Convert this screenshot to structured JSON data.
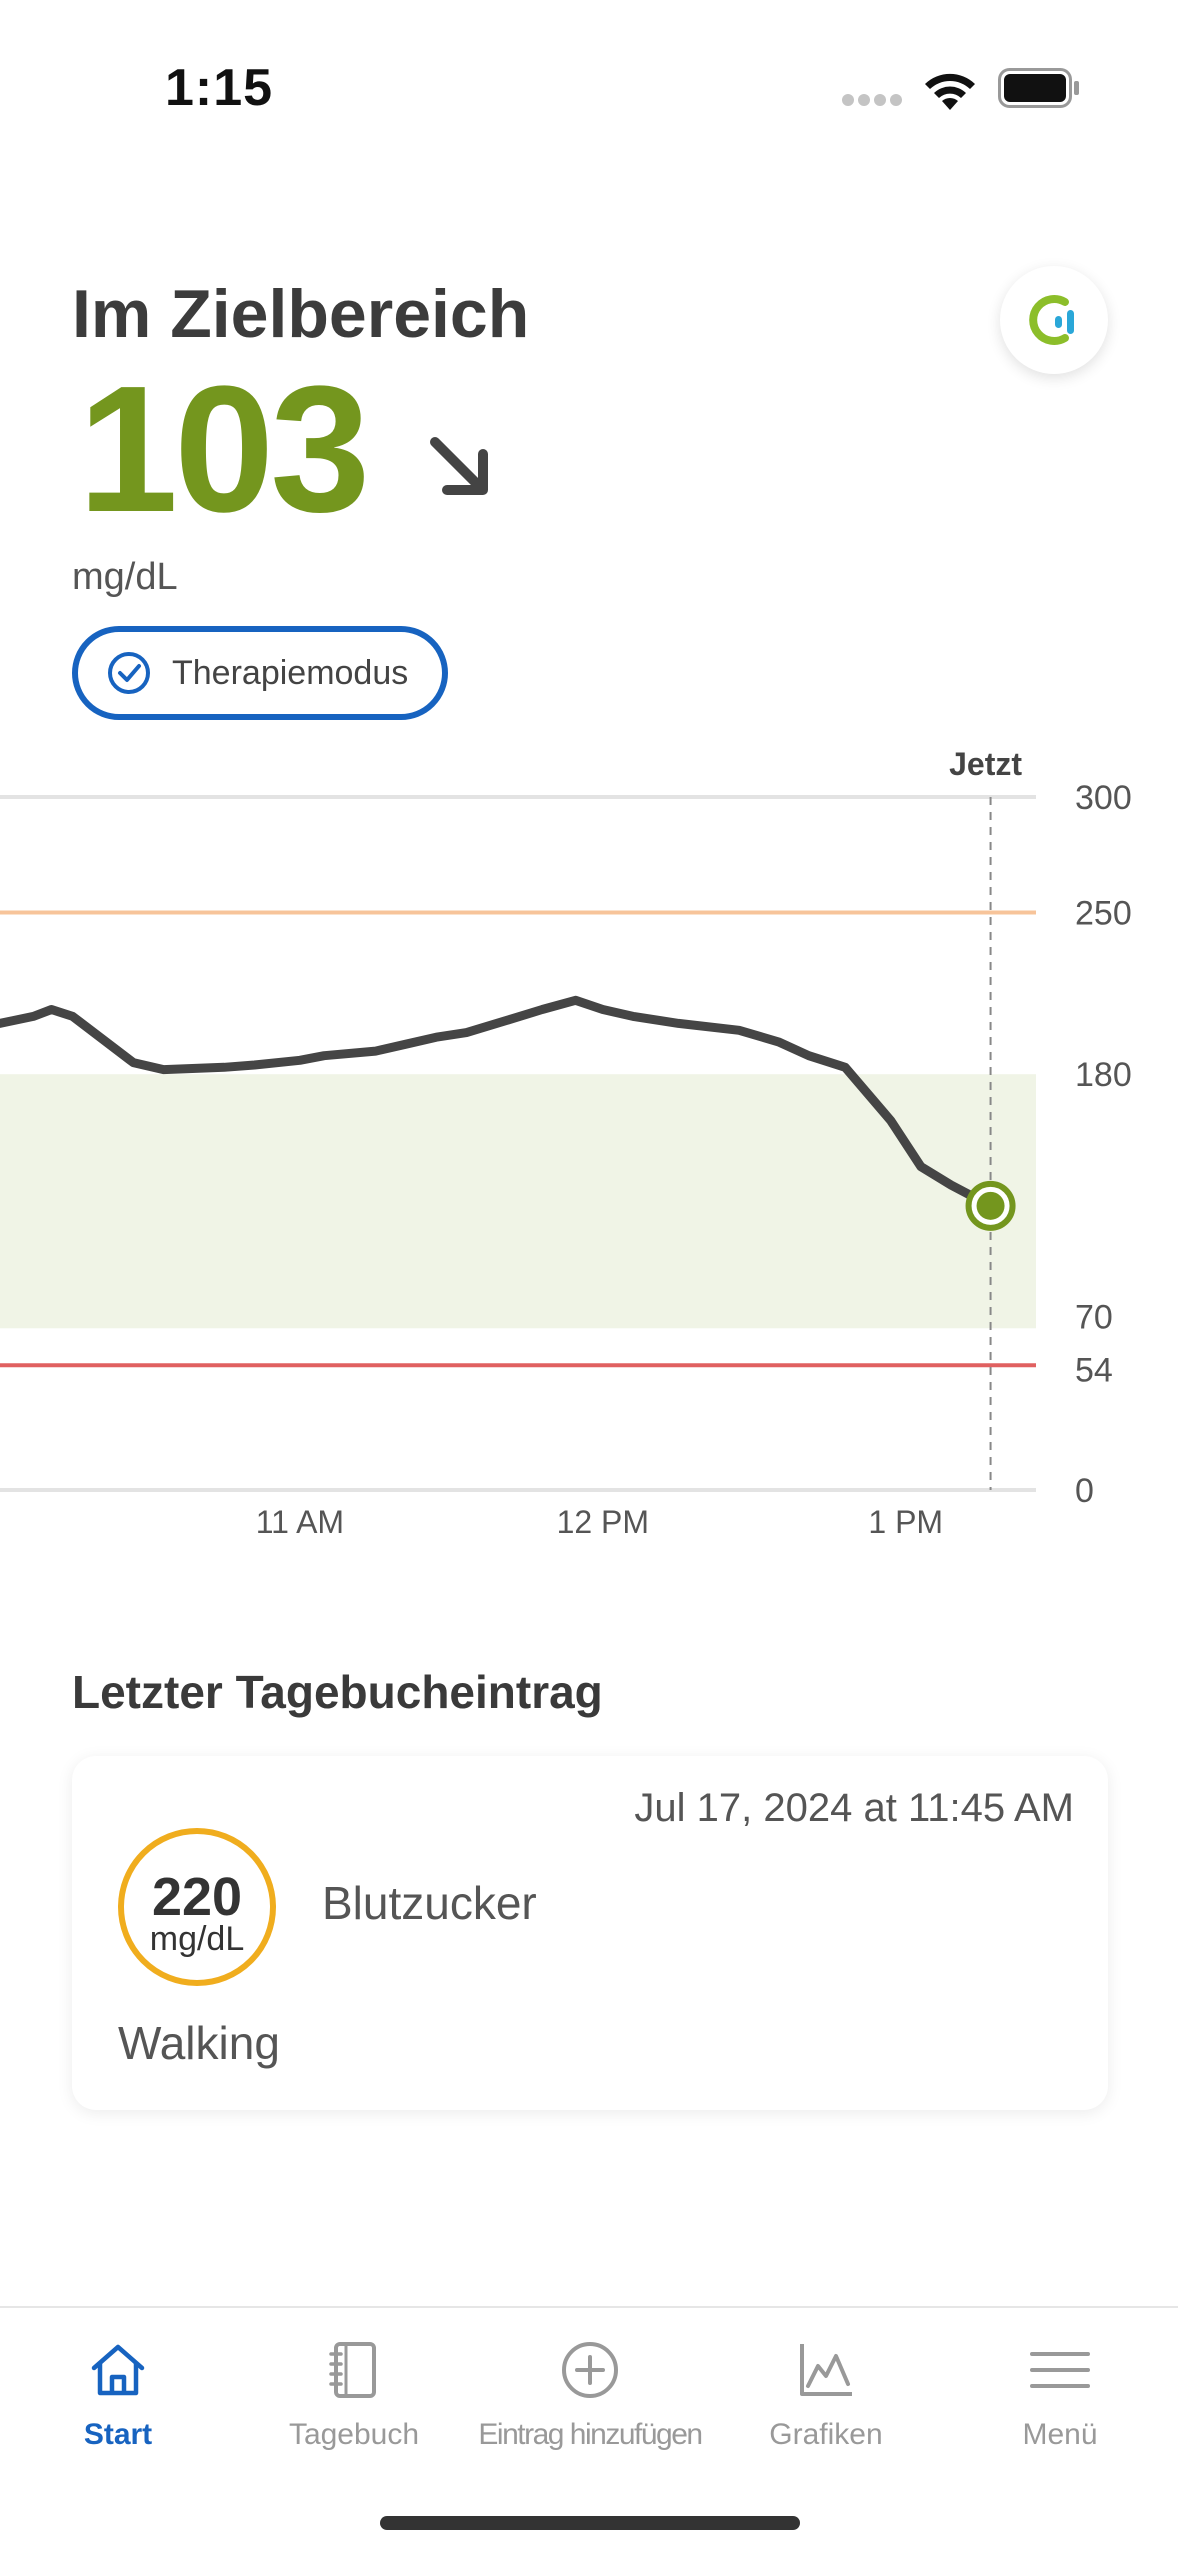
{
  "status_bar": {
    "time": "1:15"
  },
  "header": {
    "title": "Im Zielbereich",
    "glucose_value": "103",
    "unit": "mg/dL",
    "trend_icon": "arrow-down-right-icon",
    "therapy_mode": "Therapiemodus"
  },
  "colors": {
    "in_range": "#74961e",
    "accent_blue": "#1763c0",
    "high_line": "#f7c49a",
    "low_line": "#e06060",
    "target_band": "#f0f4e6",
    "entry_badge": "#f0ad1e"
  },
  "chart_data": {
    "type": "line",
    "x_tick_labels": [
      "11 AM",
      "12 PM",
      "1 PM"
    ],
    "x_ticks_hours": [
      11,
      12,
      13
    ],
    "xlim_hours": [
      10.01,
      13.43
    ],
    "y_tick_labels": [
      "300",
      "250",
      "180",
      "70",
      "54",
      "0"
    ],
    "y_ticks": [
      300,
      250,
      180,
      70,
      54,
      0
    ],
    "ylim": [
      0,
      300
    ],
    "target_range": [
      70,
      180
    ],
    "high_threshold": 250,
    "low_threshold": 54,
    "now_label": "Jetzt",
    "now_hour": 13.28,
    "series": [
      {
        "x": [
          10.01,
          10.12,
          10.18,
          10.25,
          10.45,
          10.55,
          10.75,
          10.85,
          11.0,
          11.08,
          11.25,
          11.35,
          11.45,
          11.55,
          11.7,
          11.8,
          11.91,
          12.0,
          12.1,
          12.25,
          12.45,
          12.58,
          12.68,
          12.8,
          12.95,
          13.05,
          13.15,
          13.28
        ],
        "y": [
          202,
          205,
          208,
          205,
          185,
          182,
          183,
          184,
          186,
          188,
          190,
          193,
          196,
          198,
          204,
          208,
          212,
          208,
          205,
          202,
          199,
          194,
          188,
          183,
          160,
          140,
          132,
          123
        ]
      }
    ]
  },
  "last_entry": {
    "section_title": "Letzter Tagebucheintrag",
    "date": "Jul 17, 2024 at 11:45 AM",
    "value": "220",
    "unit": "mg/dL",
    "type": "Blutzucker",
    "note": "Walking"
  },
  "tabbar": {
    "items": [
      {
        "label": "Start",
        "icon": "home-icon"
      },
      {
        "label": "Tagebuch",
        "icon": "notebook-icon"
      },
      {
        "label": "Eintrag hinzufügen",
        "icon": "plus-circle-icon"
      },
      {
        "label": "Grafiken",
        "icon": "chart-icon"
      },
      {
        "label": "Menü",
        "icon": "menu-icon"
      }
    ]
  }
}
